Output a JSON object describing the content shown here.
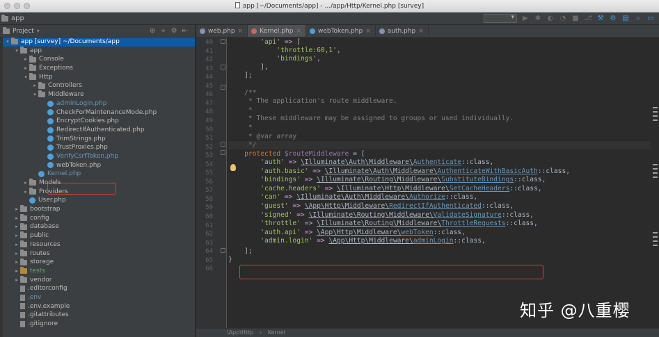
{
  "titlebar": {
    "title": "app [~/Documents/app] - .../app/Http/Kernel.php [survey]"
  },
  "navbar": {
    "breadcrumb": "app"
  },
  "project": {
    "header": "Project",
    "tree": [
      {
        "label": "app [survey] ~/Documents/app",
        "type": "folder-root",
        "indent": 0,
        "arrow": "▼"
      },
      {
        "label": "app",
        "type": "folder",
        "indent": 1,
        "arrow": "▼"
      },
      {
        "label": "Console",
        "type": "folder",
        "indent": 2,
        "arrow": "▶"
      },
      {
        "label": "Exceptions",
        "type": "folder",
        "indent": 2,
        "arrow": "▶"
      },
      {
        "label": "Http",
        "type": "folder",
        "indent": 2,
        "arrow": "▼"
      },
      {
        "label": "Controllers",
        "type": "folder",
        "indent": 3,
        "arrow": "▶"
      },
      {
        "label": "Middleware",
        "type": "folder",
        "indent": 3,
        "arrow": "▼"
      },
      {
        "label": "adminLogin.php",
        "type": "class",
        "indent": 4,
        "color": "blue"
      },
      {
        "label": "CheckForMaintenanceMode.php",
        "type": "class",
        "indent": 4
      },
      {
        "label": "EncryptCookies.php",
        "type": "class",
        "indent": 4
      },
      {
        "label": "RedirectIfAuthenticated.php",
        "type": "class",
        "indent": 4
      },
      {
        "label": "TrimStrings.php",
        "type": "class",
        "indent": 4
      },
      {
        "label": "TrustProxies.php",
        "type": "class",
        "indent": 4
      },
      {
        "label": "VerifyCsrfToken.php",
        "type": "class",
        "indent": 4,
        "color": "blue"
      },
      {
        "label": "webToken.php",
        "type": "class",
        "indent": 4
      },
      {
        "label": "Kernel.php",
        "type": "class",
        "indent": 3,
        "color": "blue"
      },
      {
        "label": "Models",
        "type": "folder",
        "indent": 2,
        "arrow": "▶"
      },
      {
        "label": "Providers",
        "type": "folder",
        "indent": 2,
        "arrow": "▶"
      },
      {
        "label": "User.php",
        "type": "class",
        "indent": 2
      },
      {
        "label": "bootstrap",
        "type": "folder",
        "indent": 1,
        "arrow": "▶"
      },
      {
        "label": "config",
        "type": "folder",
        "indent": 1,
        "arrow": "▶"
      },
      {
        "label": "database",
        "type": "folder",
        "indent": 1,
        "arrow": "▶"
      },
      {
        "label": "public",
        "type": "folder",
        "indent": 1,
        "arrow": "▶"
      },
      {
        "label": "resources",
        "type": "folder",
        "indent": 1,
        "arrow": "▶"
      },
      {
        "label": "routes",
        "type": "folder",
        "indent": 1,
        "arrow": "▶"
      },
      {
        "label": "storage",
        "type": "folder",
        "indent": 1,
        "arrow": "▶"
      },
      {
        "label": "tests",
        "type": "folder-test",
        "indent": 1,
        "arrow": "▶"
      },
      {
        "label": "vendor",
        "type": "folder",
        "indent": 1,
        "arrow": "▶"
      },
      {
        "label": ".editorconfig",
        "type": "file",
        "indent": 1
      },
      {
        "label": ".env",
        "type": "file",
        "indent": 1,
        "color": "blue"
      },
      {
        "label": ".env.example",
        "type": "file",
        "indent": 1
      },
      {
        "label": ".gitattributes",
        "type": "file",
        "indent": 1
      },
      {
        "label": ".gitignore",
        "type": "file",
        "indent": 1
      }
    ]
  },
  "tabs": [
    {
      "label": "web.php",
      "icon": "gray",
      "active": false
    },
    {
      "label": "Kernel.php",
      "icon": "red",
      "active": true
    },
    {
      "label": "webToken.php",
      "icon": "blue",
      "active": false
    },
    {
      "label": "auth.php",
      "icon": "gray",
      "active": false
    }
  ],
  "editor": {
    "line_numbers": [
      "40",
      "41",
      "42",
      "43",
      "44",
      "45",
      "46",
      "47",
      "48",
      "49",
      "50",
      "51",
      "52",
      "53",
      "54",
      "55",
      "56",
      "57",
      "58",
      "59",
      "60",
      "61",
      "62",
      "63",
      "64",
      "65",
      "66"
    ],
    "breadcrumb": [
      "\\App\\Http",
      "Kernel"
    ]
  },
  "code": {
    "l40": [
      "'api'",
      "=> ["
    ],
    "l41": "'throttle:60,1'",
    "l42": "'bindings'",
    "l43": "],",
    "l44": "];",
    "l46": "/**",
    "l47": "* The application's route middleware.",
    "l48": "*",
    "l49": "* These middleware may be assigned to groups or used individually.",
    "l50": "*",
    "l51": "* @var array",
    "l52": "*/",
    "l53a": "protected",
    "l53b": "$routeMiddleware",
    "l53c": " = [",
    "mw": [
      {
        "key": "'auth'",
        "ns": "\\Illuminate\\Auth\\Middleware\\",
        "cls": "Authenticate"
      },
      {
        "key": "'auth.basic'",
        "ns": "\\Illuminate\\Auth\\Middleware\\",
        "cls": "AuthenticateWithBasicAuth"
      },
      {
        "key": "'bindings'",
        "ns": "\\Illuminate\\Routing\\Middleware\\",
        "cls": "SubstituteBindings"
      },
      {
        "key": "'cache.headers'",
        "ns": "\\Illuminate\\Http\\Middleware\\",
        "cls": "SetCacheHeaders"
      },
      {
        "key": "'can'",
        "ns": "\\Illuminate\\Auth\\Middleware\\",
        "cls": "Authorize"
      },
      {
        "key": "'guest'",
        "ns": "\\App\\Http\\Middleware\\",
        "cls": "RedirectIfAuthenticated"
      },
      {
        "key": "'signed'",
        "ns": "\\Illuminate\\Routing\\Middleware\\",
        "cls": "ValidateSignature"
      },
      {
        "key": "'throttle'",
        "ns": "\\Illuminate\\Routing\\Middleware\\",
        "cls": "ThrottleRequests"
      },
      {
        "key": "'auth.api'",
        "ns": "\\App\\Http\\Middleware\\",
        "cls": "webToken"
      },
      {
        "key": "'admin.login'",
        "ns": "\\App\\Http\\Middleware\\",
        "cls": "adminLogin"
      }
    ],
    "class_suffix": "::class,",
    "arrow": "=>",
    "l64": "];",
    "l65": "}"
  },
  "watermark": "知乎 @八重樱"
}
